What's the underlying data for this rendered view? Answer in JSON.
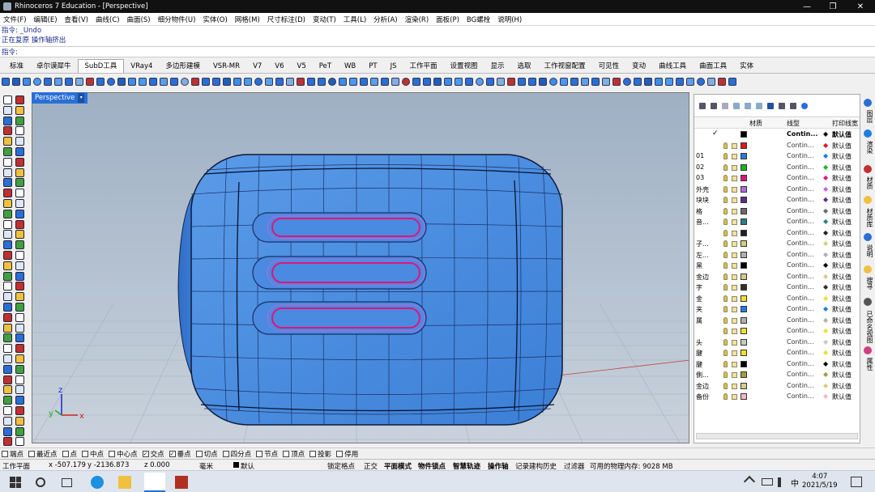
{
  "window": {
    "title": "Rhinoceros 7 Education - [Perspective]",
    "minimize_glyph": "—",
    "maximize_glyph": "❐",
    "close_glyph": "✕"
  },
  "menu": [
    "文件(F)",
    "编辑(E)",
    "查看(V)",
    "曲线(C)",
    "曲面(S)",
    "细分物件(U)",
    "实体(O)",
    "网格(M)",
    "尺寸标注(D)",
    "变动(T)",
    "工具(L)",
    "分析(A)",
    "渲染(R)",
    "面板(P)",
    "BG螺栓",
    "说明(H)"
  ],
  "command_history": [
    "指令: _Undo",
    "正在复原 操作轴挤出"
  ],
  "command_prompt": "指令:",
  "tabs": [
    "标准",
    "卓尔谟犀牛",
    "SubD工具",
    "VRay4",
    "多边形建模",
    "VSR-MR",
    "V7",
    "V6",
    "V5",
    "PeT",
    "WB",
    "PT",
    "JS",
    "工作平面",
    "设置视图",
    "显示",
    "选取",
    "工作视窗配置",
    "可见性",
    "变动",
    "曲线工具",
    "曲面工具",
    "实体"
  ],
  "active_tab": "SubD工具",
  "viewport": {
    "label": "Perspective",
    "dropdown": "▾",
    "axis_x": "x",
    "axis_y": "y",
    "axis_z": "z"
  },
  "layer_panel": {
    "columns": {
      "material": "材质",
      "linetype": "线型",
      "print_width": "打印线宽"
    },
    "rows": [
      {
        "name": "",
        "color": "#000000",
        "linetype": "Contin...",
        "print": "默认值",
        "diamond": "#000000",
        "current": true
      },
      {
        "name": "",
        "color": "#e01818",
        "linetype": "Contin...",
        "print": "默认值",
        "diamond": "#e01818"
      },
      {
        "name": "01",
        "color": "#1f7de0",
        "linetype": "Contin...",
        "print": "默认值",
        "diamond": "#1f7de0"
      },
      {
        "name": "02",
        "color": "#1bb51b",
        "linetype": "Contin...",
        "print": "默认值",
        "diamond": "#1bb51b"
      },
      {
        "name": "03",
        "color": "#e0157a",
        "linetype": "Contin...",
        "print": "默认值",
        "diamond": "#e0157a"
      },
      {
        "name": "外壳",
        "color": "#b46ae0",
        "linetype": "Contin...",
        "print": "默认值",
        "diamond": "#b46ae0"
      },
      {
        "name": "块块",
        "color": "#5a2e8a",
        "linetype": "Contin...",
        "print": "默认值",
        "diamond": "#5a2e8a"
      },
      {
        "name": "格",
        "color": "#6b6b6b",
        "linetype": "Contin...",
        "print": "默认值",
        "diamond": "#6b6b6b"
      },
      {
        "name": "音...",
        "color": "#2a7f7f",
        "linetype": "Contin...",
        "print": "默认值",
        "diamond": "#2a7f7f"
      },
      {
        "name": "",
        "color": "#202020",
        "linetype": "Contin...",
        "print": "默认值",
        "diamond": "#202020"
      },
      {
        "name": "子...",
        "color": "#d8cd80",
        "linetype": "Contin...",
        "print": "默认值",
        "diamond": "#d8cd80"
      },
      {
        "name": "左...",
        "color": "#b0b0b0",
        "linetype": "Contin...",
        "print": "默认值",
        "diamond": "#b0b0b0"
      },
      {
        "name": "黑",
        "color": "#000000",
        "linetype": "Contin...",
        "print": "默认值",
        "diamond": "#000000"
      },
      {
        "name": "金边",
        "color": "#d6cc8a",
        "linetype": "Contin...",
        "print": "默认值",
        "diamond": "#d6cc8a"
      },
      {
        "name": "字",
        "color": "#3a2a2a",
        "linetype": "Contin...",
        "print": "默认值",
        "diamond": "#3a2a2a"
      },
      {
        "name": "金",
        "color": "#f0e030",
        "linetype": "Contin...",
        "print": "默认值",
        "diamond": "#f0e030"
      },
      {
        "name": "夹",
        "color": "#1f7de0",
        "linetype": "Contin...",
        "print": "默认值",
        "diamond": "#1f7de0"
      },
      {
        "name": "属",
        "color": "#b0b0b0",
        "linetype": "Contin...",
        "print": "默认值",
        "diamond": "#b0b0b0"
      },
      {
        "name": "",
        "color": "#f0e030",
        "linetype": "Contin...",
        "print": "默认值",
        "diamond": "#f0e030"
      },
      {
        "name": "头",
        "color": "#c8c8c8",
        "linetype": "Contin...",
        "print": "默认值",
        "diamond": "#c8c8c8"
      },
      {
        "name": "腱",
        "color": "#f0e030",
        "linetype": "Contin...",
        "print": "默认值",
        "diamond": "#f0e030"
      },
      {
        "name": "腱",
        "color": "#000000",
        "linetype": "Contin...",
        "print": "默认值",
        "diamond": "#000000"
      },
      {
        "name": "側...",
        "color": "#a89a3a",
        "linetype": "Contin...",
        "print": "默认值",
        "diamond": "#a89a3a"
      },
      {
        "name": "金边",
        "color": "#d6cc8a",
        "linetype": "Contin...",
        "print": "默认值",
        "diamond": "#d6cc8a"
      },
      {
        "name": "备份",
        "color": "#f2b8c6",
        "linetype": "Contin...",
        "print": "默认值",
        "diamond": "#f2b8c6"
      }
    ]
  },
  "side_tabs": [
    "图层",
    "渲染",
    "材质",
    "材质库",
    "说明",
    "搜寻",
    "已命名视图",
    "属性"
  ],
  "osnap": [
    {
      "label": "端点",
      "checked": false
    },
    {
      "label": "最近点",
      "checked": false
    },
    {
      "label": "点",
      "checked": false
    },
    {
      "label": "中点",
      "checked": false
    },
    {
      "label": "中心点",
      "checked": false
    },
    {
      "label": "交点",
      "checked": true
    },
    {
      "label": "垂点",
      "checked": true
    },
    {
      "label": "切点",
      "checked": false
    },
    {
      "label": "四分点",
      "checked": false
    },
    {
      "label": "节点",
      "checked": false
    },
    {
      "label": "顶点",
      "checked": false
    },
    {
      "label": "投影",
      "checked": false
    },
    {
      "label": "停用",
      "checked": false
    }
  ],
  "status": {
    "cplane": "工作平面",
    "x": "x -507.179",
    "y": "y -2136.873",
    "z": "z 0.000",
    "unit": "毫米",
    "layer": "默认",
    "grid_snap": "锁定格点",
    "ortho": "正交",
    "planar": "平面模式",
    "osnap": "物件锁点",
    "smart_track": "智慧轨迹",
    "gumball": "操作轴",
    "history": "记录建构历史",
    "filter": "过滤器",
    "memory": "可用的物理内存: 9028 MB"
  },
  "taskbar": {
    "time": "4:07",
    "date": "2021/5/19",
    "ime": "中"
  }
}
